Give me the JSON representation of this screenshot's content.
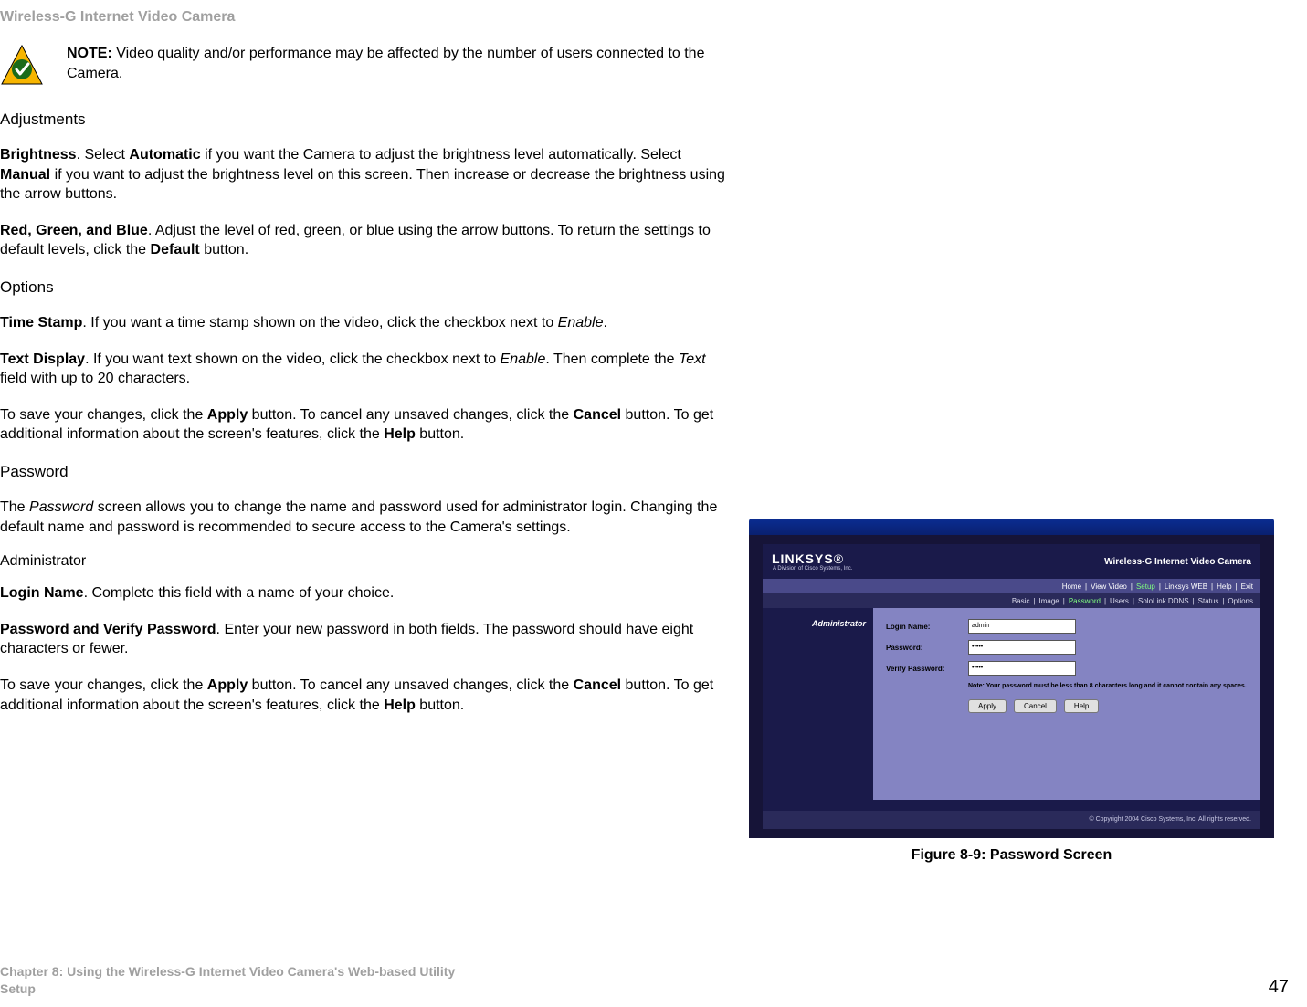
{
  "header": "Wireless-G Internet Video Camera",
  "note": {
    "label": "NOTE:",
    "text": " Video quality and/or performance may be affected by the number of users connected to the Camera."
  },
  "adjustments": {
    "heading": "Adjustments",
    "brightness_p1a": "Brightness",
    "brightness_p1b": ". Select ",
    "brightness_p1c": "Automatic",
    "brightness_p1d": " if you want the Camera to adjust the brightness level automatically. Select ",
    "brightness_p1e": "Manual",
    "brightness_p1f": " if you want to adjust the brightness level on this screen. Then increase or decrease the brightness using the arrow buttons.",
    "rgb_a": "Red, Green, and Blue",
    "rgb_b": ". Adjust the level of red, green, or blue using the arrow buttons. To return the settings to default levels, click the ",
    "rgb_c": "Default",
    "rgb_d": " button."
  },
  "options": {
    "heading": "Options",
    "ts_a": "Time Stamp",
    "ts_b": ". If you want a time stamp shown on the video, click the checkbox next to ",
    "ts_c": "Enable",
    "ts_d": ".",
    "td_a": "Text Display",
    "td_b": ". If you want text shown on the video, click the checkbox next to ",
    "td_c": "Enable",
    "td_d": ". Then complete the ",
    "td_e": "Text",
    "td_f": " field with up to 20 characters.",
    "save_a": "To save your changes, click the ",
    "save_b": "Apply",
    "save_c": " button. To cancel any unsaved changes, click the ",
    "save_d": "Cancel",
    "save_e": " button. To get additional information about the screen's features, click the ",
    "save_f": "Help",
    "save_g": " button."
  },
  "password": {
    "heading": "Password",
    "intro_a": "The ",
    "intro_b": "Password",
    "intro_c": " screen allows you to change the name and password used for administrator login. Changing the default name and password is recommended to secure access to the Camera's settings.",
    "admin": "Administrator",
    "login_a": "Login Name",
    "login_b": ". Complete this field with a name of your choice.",
    "pw_a": "Password and Verify Password",
    "pw_b": ". Enter your new password in both fields. The password should have eight characters or fewer.",
    "save_a": "To save your changes, click the ",
    "save_b": "Apply",
    "save_c": " button. To cancel any unsaved changes, click the ",
    "save_d": "Cancel",
    "save_e": " button. To get additional information about the screen's features, click the ",
    "save_f": "Help",
    "save_g": " button."
  },
  "figure": {
    "caption": "Figure 8-9: Password Screen",
    "logo": "LINKSYS",
    "logo_sub": "A Division of Cisco Systems, Inc.",
    "product": "Wireless-G Internet Video Camera",
    "nav1": [
      "Home",
      "|",
      "View Video",
      "|",
      "Setup",
      "|",
      "Linksys WEB",
      "|",
      "Help",
      "|",
      "Exit"
    ],
    "nav1_active_index": 4,
    "nav2": [
      "Basic",
      "|",
      "Image",
      "|",
      "Password",
      "|",
      "Users",
      "|",
      "SoloLink DDNS",
      "|",
      "Status",
      "|",
      "Options"
    ],
    "nav2_active_index": 4,
    "side_label": "Administrator",
    "form": {
      "login_label": "Login Name:",
      "login_value": "admin",
      "pw_label": "Password:",
      "pw_value": "•••••",
      "vpw_label": "Verify Password:",
      "vpw_value": "•••••",
      "note": "Note: Your password must be less than 8 characters long and it cannot contain any spaces.",
      "btn_apply": "Apply",
      "btn_cancel": "Cancel",
      "btn_help": "Help"
    },
    "copyright": "© Copyright 2004 Cisco Systems, Inc. All rights reserved."
  },
  "footer": {
    "chapter": "Chapter 8: Using the Wireless-G Internet Video Camera's Web-based Utility",
    "section": "Setup",
    "page": "47"
  }
}
